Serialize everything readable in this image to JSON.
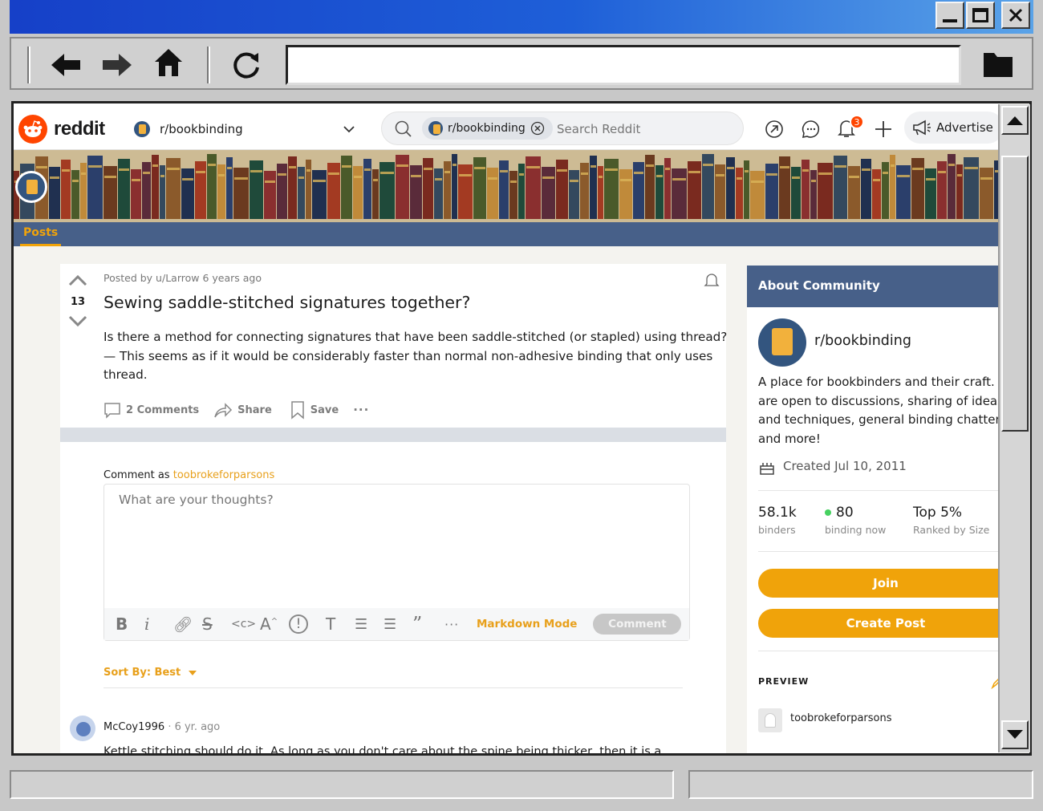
{
  "browser": {
    "window_buttons": [
      "minimize",
      "maximize",
      "close"
    ],
    "url": "",
    "icons": [
      "back-arrow-icon",
      "forward-arrow-icon",
      "home-icon",
      "refresh-icon",
      "folder-icon"
    ]
  },
  "header": {
    "logo_text": "reddit",
    "community": "r/bookbinding",
    "search_chip": "r/bookbinding",
    "search_placeholder": "Search Reddit",
    "notification_count": "3",
    "advertise_label": "Advertise"
  },
  "tabs": {
    "active": "Posts"
  },
  "post": {
    "meta": "Posted by u/Larrow 6 years ago",
    "votes": "13",
    "title": "Sewing saddle-stitched signatures together?",
    "body_lines": [
      "Is there a method for connecting signatures that have been saddle-stitched (or stapled) using thread?",
      "— This seems as if it would be considerably faster than normal non-adhesive binding that only uses",
      "thread."
    ],
    "comments_label": "2 Comments",
    "share_label": "Share",
    "save_label": "Save",
    "more_label": "···"
  },
  "comment_box": {
    "comment_as_label": "Comment as",
    "username": "toobrokeforparsons",
    "placeholder": "What are your thoughts?",
    "markdown_mode": "Markdown Mode",
    "comment_button": "Comment",
    "sort_label": "Sort By: Best"
  },
  "first_comment": {
    "author": "McCoy1996",
    "age": "6 yr. ago",
    "text": "Kettle stitching should do it. As long as you don't care about the spine being thicker, then it is a"
  },
  "sidebar": {
    "heading": "About Community",
    "name": "r/bookbinding",
    "description_lines": [
      "A place for bookbinders and their craft. W",
      "are open to discussions, sharing of ideas",
      "and techniques, general binding chatter",
      "and more!"
    ],
    "created": "Created Jul 10, 2011",
    "stats": [
      {
        "value": "58.1k",
        "label": "binders"
      },
      {
        "value": "80",
        "label": "binding now"
      },
      {
        "value": "Top 5%",
        "label": "Ranked by Size"
      }
    ],
    "join_label": "Join",
    "create_post_label": "Create Post",
    "preview_label": "PREVIEW",
    "preview_user": "toobrokeforparsons"
  },
  "colors": {
    "reddit_orange": "#ff4500",
    "tab_bar": "#476089",
    "accent_yellow": "#f0a30a",
    "link_orange": "#e8a01b"
  }
}
